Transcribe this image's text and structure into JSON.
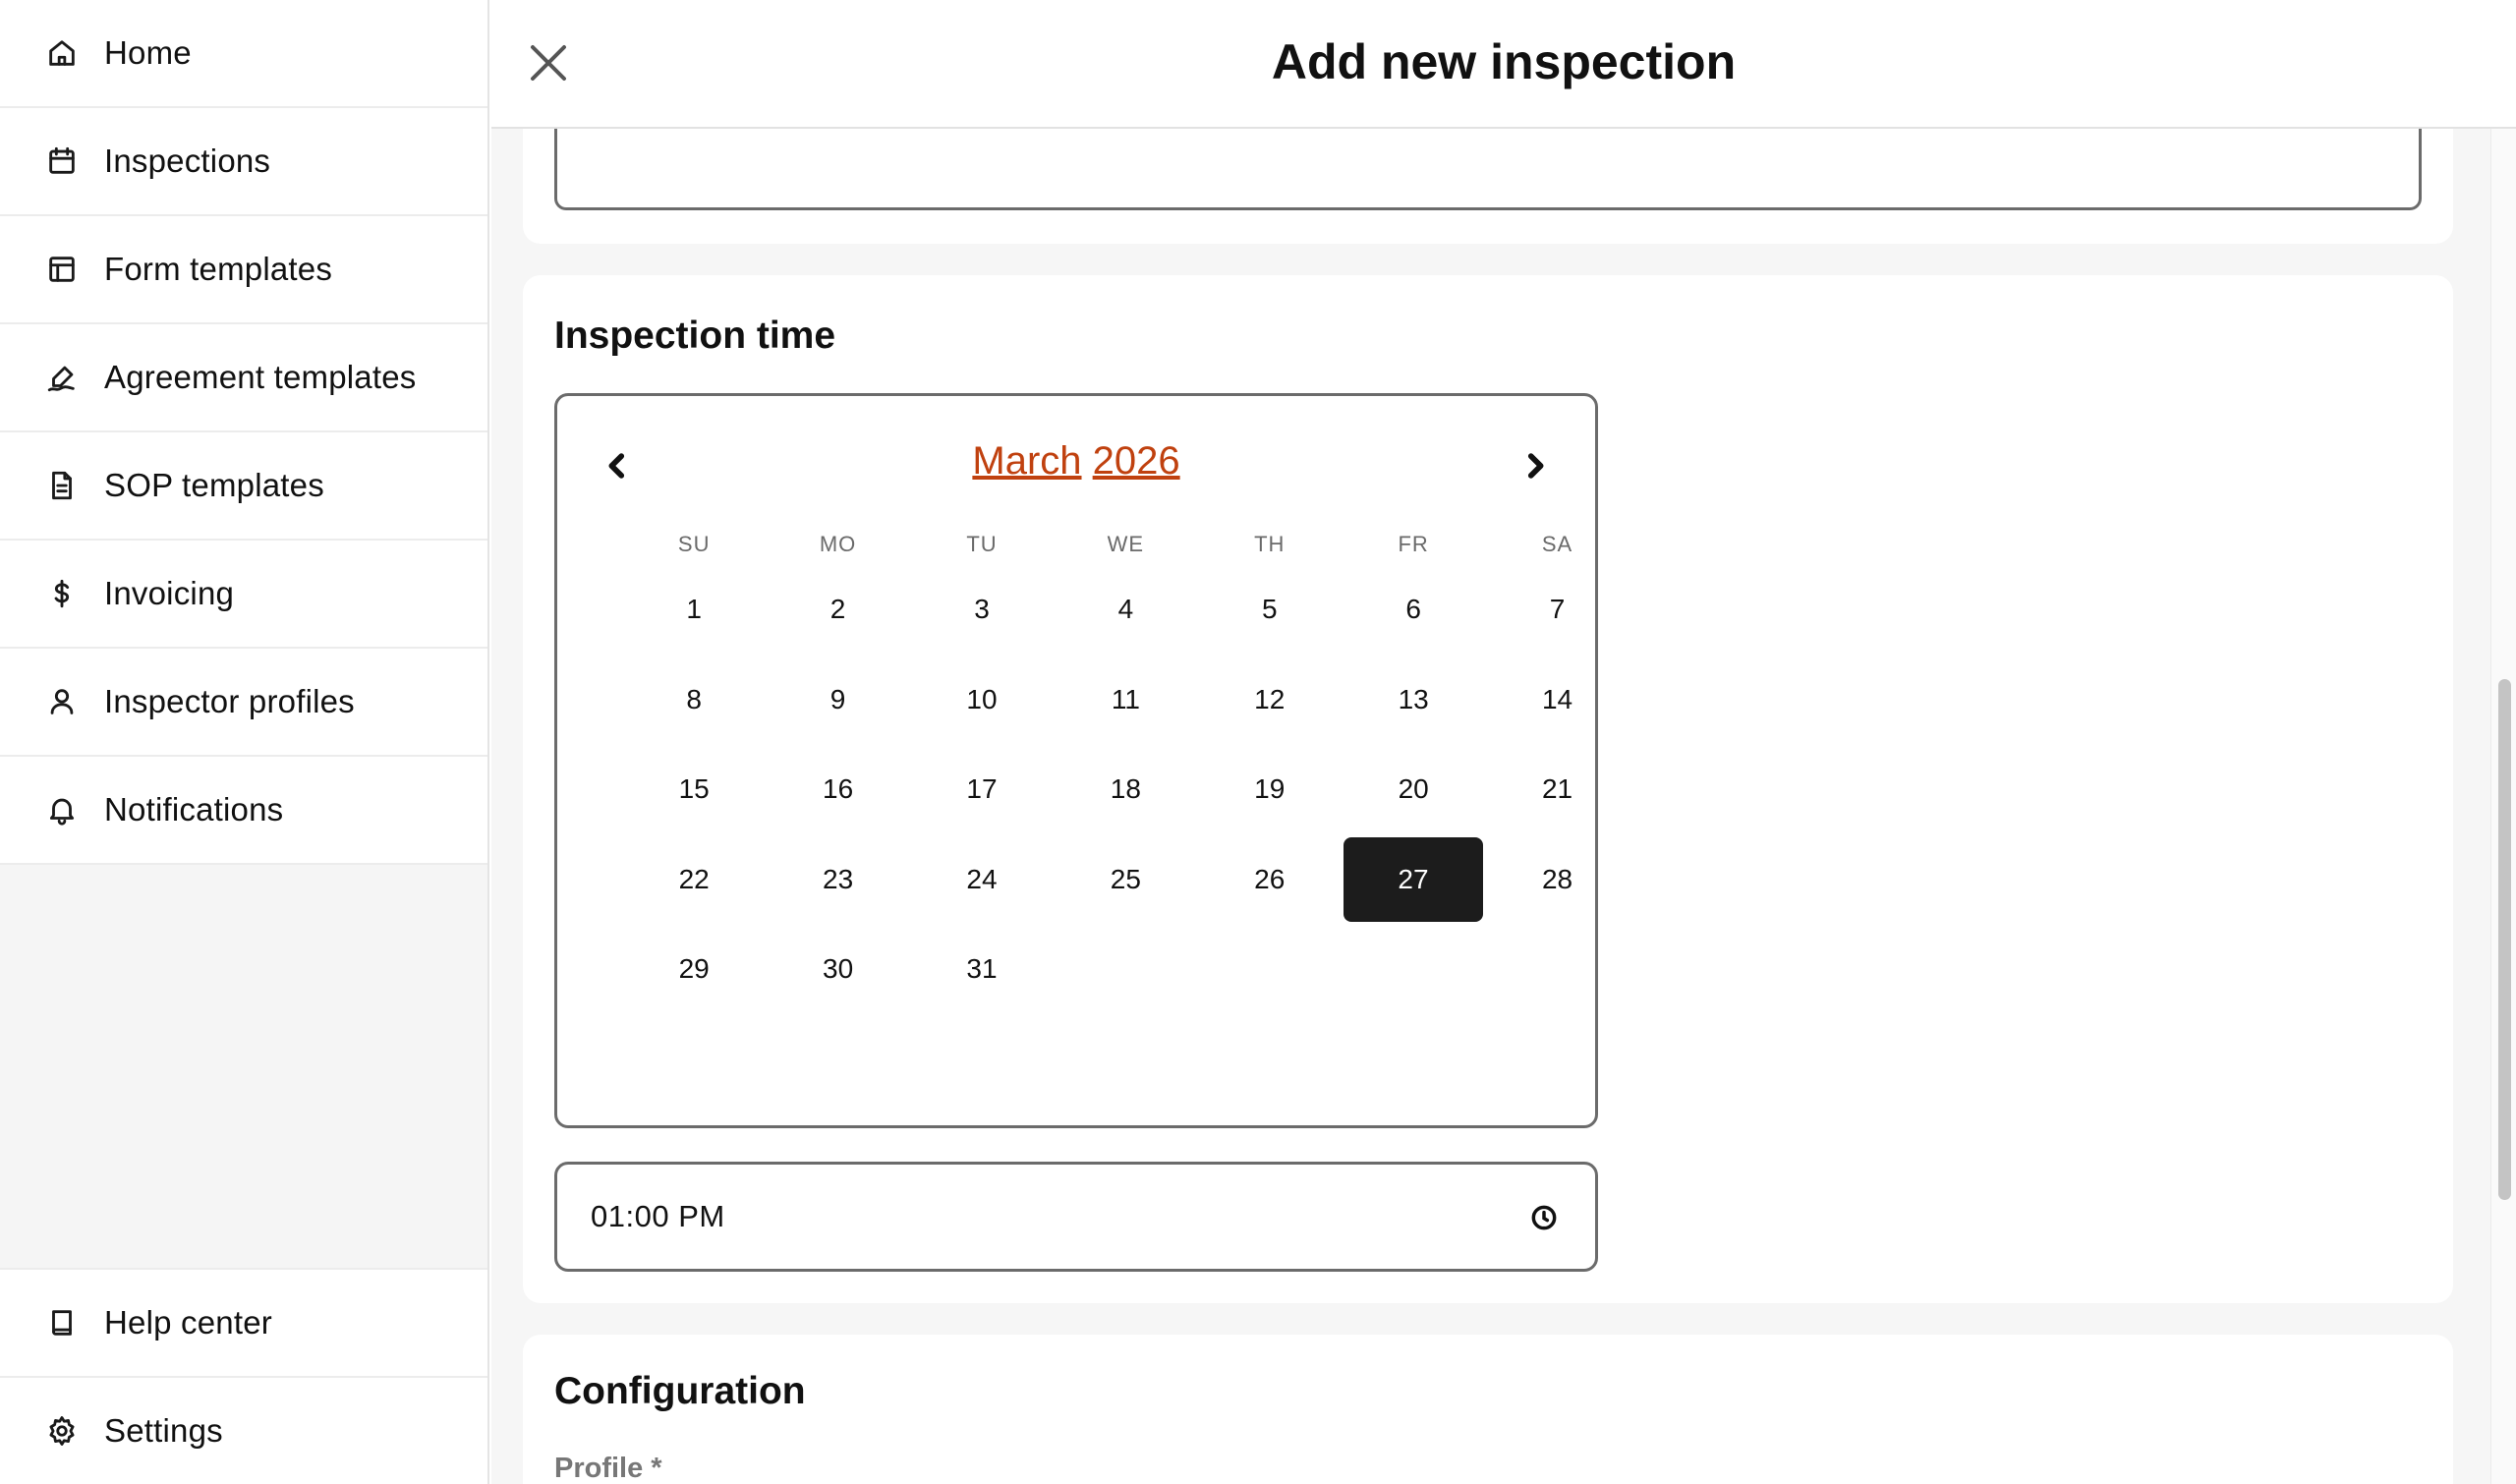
{
  "sidebar": {
    "items": [
      {
        "label": "Home",
        "icon": "home-icon"
      },
      {
        "label": "Inspections",
        "icon": "calendar-icon"
      },
      {
        "label": "Form templates",
        "icon": "layout-icon"
      },
      {
        "label": "Agreement templates",
        "icon": "signature-icon"
      },
      {
        "label": "SOP templates",
        "icon": "document-icon"
      },
      {
        "label": "Invoicing",
        "icon": "dollar-icon"
      },
      {
        "label": "Inspector profiles",
        "icon": "user-icon"
      },
      {
        "label": "Notifications",
        "icon": "bell-icon"
      }
    ],
    "bottom_items": [
      {
        "label": "Help center",
        "icon": "book-icon"
      },
      {
        "label": "Settings",
        "icon": "gear-icon"
      }
    ]
  },
  "header": {
    "title": "Add new inspection",
    "close_icon": "close-icon"
  },
  "inspection_time": {
    "title": "Inspection time",
    "calendar": {
      "month": "March",
      "year": "2026",
      "weekdays": [
        "SU",
        "MO",
        "TU",
        "WE",
        "TH",
        "FR",
        "SA"
      ],
      "weeks": [
        [
          "1",
          "2",
          "3",
          "4",
          "5",
          "6",
          "7"
        ],
        [
          "8",
          "9",
          "10",
          "11",
          "12",
          "13",
          "14"
        ],
        [
          "15",
          "16",
          "17",
          "18",
          "19",
          "20",
          "21"
        ],
        [
          "22",
          "23",
          "24",
          "25",
          "26",
          "27",
          "28"
        ],
        [
          "29",
          "30",
          "31",
          "",
          "",
          "",
          ""
        ]
      ],
      "selected_day": "27",
      "accent_color": "#c0410f"
    },
    "time_value": "01:00 PM",
    "time_icon": "clock-icon"
  },
  "configuration": {
    "title": "Configuration",
    "profile_label": "Profile *"
  }
}
